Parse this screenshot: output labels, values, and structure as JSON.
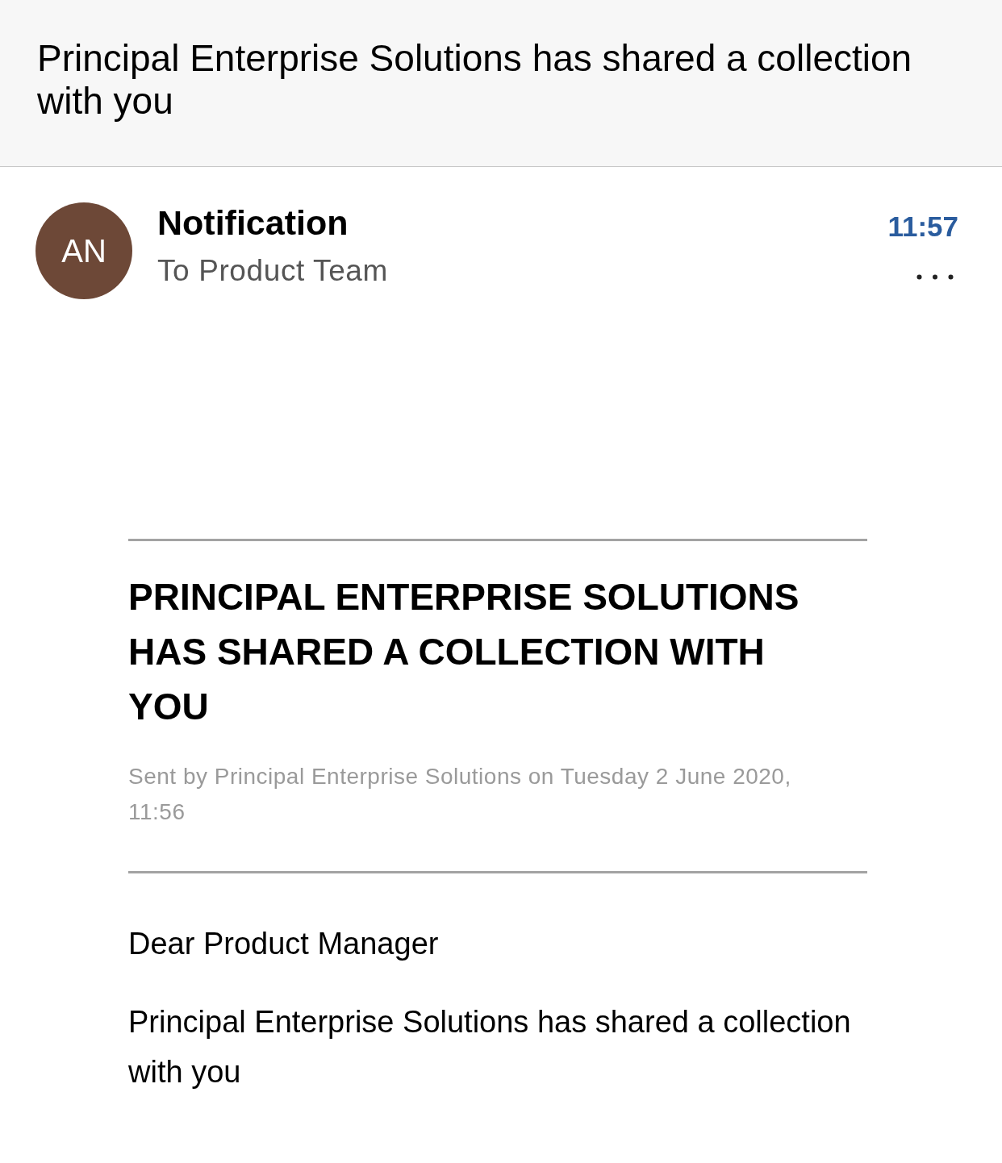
{
  "header": {
    "subject": "Principal Enterprise Solutions has shared a collection with you"
  },
  "sender": {
    "initials": "AN",
    "name": "Notification",
    "recipients": "To Product Team",
    "time": "11:57"
  },
  "email_body": {
    "heading": "PRINCIPAL ENTERPRISE SOLUTIONS HAS SHARED A COLLECTION WITH YOU",
    "sent_info": "Sent by Principal Enterprise Solutions on Tuesday 2 June 2020, 11:56",
    "greeting": "Dear Product Manager",
    "paragraphs": [
      "Principal Enterprise Solutions has shared a collection with you"
    ]
  }
}
